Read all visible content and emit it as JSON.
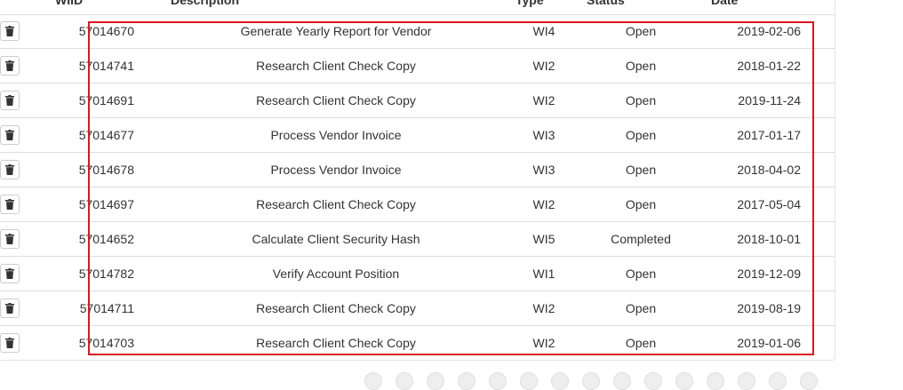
{
  "table": {
    "headers": {
      "wiid": "WIID",
      "description": "Description",
      "type": "Type",
      "status": "Status",
      "date": "Date"
    },
    "delete_icon": "trash-icon",
    "rows": [
      {
        "wiid": "57014670",
        "description": "Generate Yearly Report for Vendor",
        "type": "WI4",
        "status": "Open",
        "date": "2019-02-06"
      },
      {
        "wiid": "57014741",
        "description": "Research Client Check Copy",
        "type": "WI2",
        "status": "Open",
        "date": "2018-01-22"
      },
      {
        "wiid": "57014691",
        "description": "Research Client Check Copy",
        "type": "WI2",
        "status": "Open",
        "date": "2019-11-24"
      },
      {
        "wiid": "57014677",
        "description": "Process Vendor Invoice",
        "type": "WI3",
        "status": "Open",
        "date": "2017-01-17"
      },
      {
        "wiid": "57014678",
        "description": "Process Vendor Invoice",
        "type": "WI3",
        "status": "Open",
        "date": "2018-04-02"
      },
      {
        "wiid": "57014697",
        "description": "Research Client Check Copy",
        "type": "WI2",
        "status": "Open",
        "date": "2017-05-04"
      },
      {
        "wiid": "57014652",
        "description": "Calculate Client Security Hash",
        "type": "WI5",
        "status": "Completed",
        "date": "2018-10-01"
      },
      {
        "wiid": "57014782",
        "description": "Verify Account Position",
        "type": "WI1",
        "status": "Open",
        "date": "2019-12-09"
      },
      {
        "wiid": "57014711",
        "description": "Research Client Check Copy",
        "type": "WI2",
        "status": "Open",
        "date": "2019-08-19"
      },
      {
        "wiid": "57014703",
        "description": "Research Client Check Copy",
        "type": "WI2",
        "status": "Open",
        "date": "2019-01-06"
      }
    ]
  },
  "highlight_color": "#d9171f",
  "pager": {
    "button_count": 15
  }
}
